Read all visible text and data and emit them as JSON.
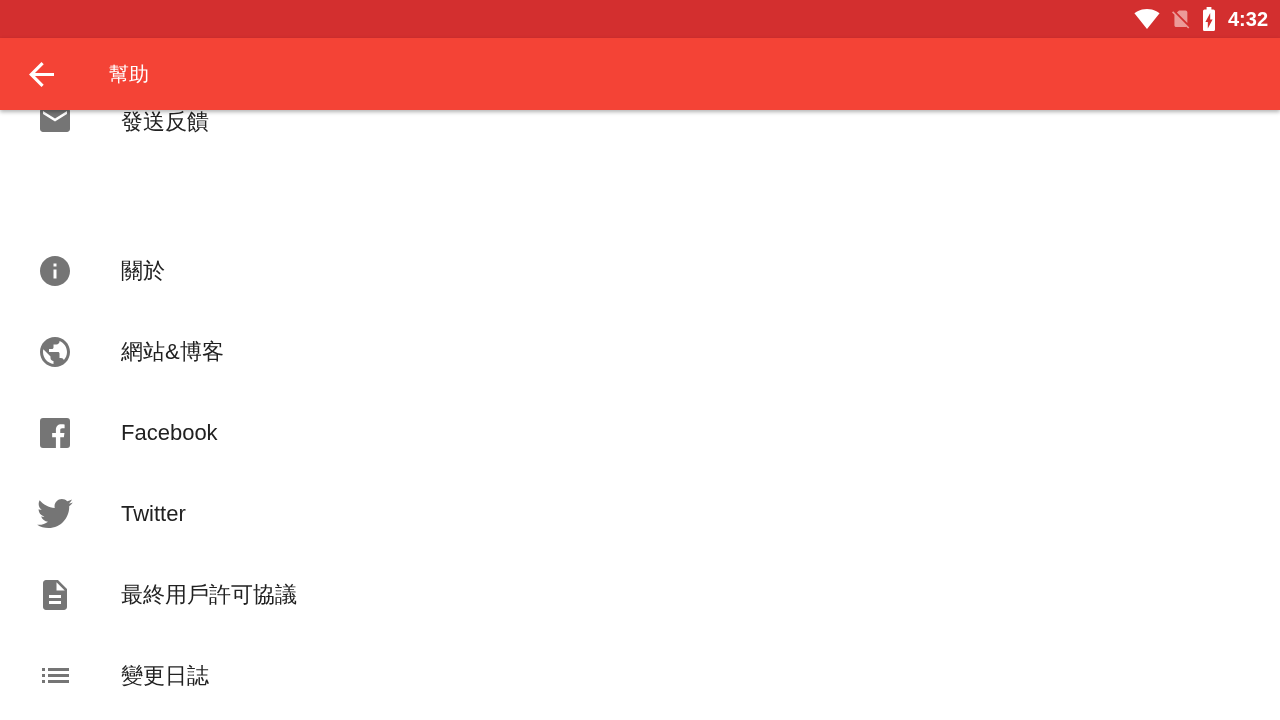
{
  "status_bar": {
    "time": "4:32"
  },
  "app_bar": {
    "title": "幫助"
  },
  "list": {
    "sections": [
      {
        "items": [
          {
            "label": "發送反饋"
          }
        ]
      },
      {
        "items": [
          {
            "label": "關於"
          },
          {
            "label": "網站&博客"
          },
          {
            "label": "Facebook"
          },
          {
            "label": "Twitter"
          },
          {
            "label": "最終用戶許可協議"
          },
          {
            "label": "變更日誌"
          }
        ]
      }
    ]
  }
}
